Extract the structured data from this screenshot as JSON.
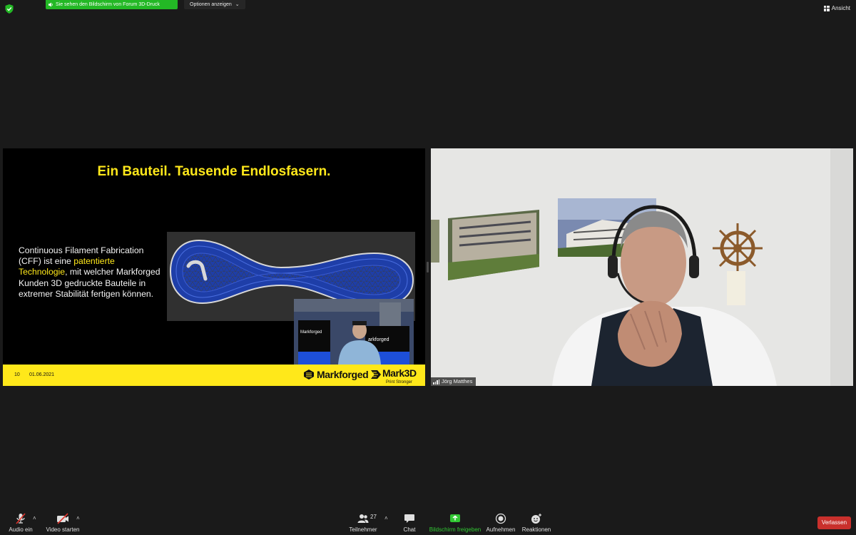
{
  "topbar": {
    "share_banner": "Sie sehen den Bildschirm von Forum 3D-Druck",
    "options": "Optionen anzeigen",
    "view": "Ansicht"
  },
  "slide": {
    "title": "Ein Bauteil. Tausende Endlosfasern.",
    "text_part1": "Continuous Filament Fabrication (CFF) ist eine ",
    "text_highlight": "patentierte Technologie",
    "text_part2": ", mit welcher Markforged Kunden 3D gedruckte Bauteile in extremer Stabilität fertigen können.",
    "page_number": "10",
    "date": "01.06.2021",
    "logo_markforged": "Markforged",
    "logo_mark3d": "Mark3D",
    "logo_mark3d_tagline": "Print Stronger",
    "pip_sign1": "Markforged",
    "pip_sign2": "arkforged"
  },
  "video": {
    "participant_name": "Jörg Matthes"
  },
  "toolbar": {
    "audio": "Audio ein",
    "video": "Video starten",
    "participants": "Teilnehmer",
    "participants_count": "27",
    "chat": "Chat",
    "share": "Bildschirm freigeben",
    "record": "Aufnehmen",
    "reactions": "Reaktionen",
    "leave": "Verlassen"
  },
  "colors": {
    "accent_green": "#23b825",
    "slide_yellow": "#ffe81a",
    "leave_red": "#c9302c"
  }
}
